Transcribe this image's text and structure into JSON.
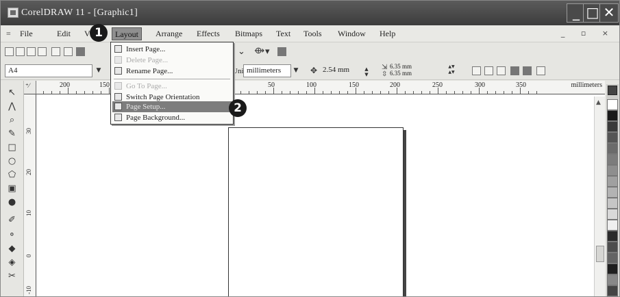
{
  "window": {
    "title": "CorelDRAW 11 - [Graphic1]",
    "controls": {
      "minimize": "_",
      "maximize": "□",
      "close": "✕"
    }
  },
  "menubar": {
    "system_icon": "≡",
    "items": [
      "File",
      "Edit",
      "View",
      "Layout",
      "Arrange",
      "Effects",
      "Bitmaps",
      "Text",
      "Tools",
      "Window",
      "Help"
    ],
    "active": "Layout",
    "mdi_controls": "_ ▫ ×"
  },
  "property_bar": {
    "paper_size": "A4",
    "units_label": "Units:",
    "units_value": "millimeters",
    "nudge_value": "2.54 mm",
    "duplicate_x": "6.35 mm",
    "duplicate_y": "6.35 mm"
  },
  "layout_menu": {
    "items": [
      {
        "label": "Insert Page...",
        "state": "enabled"
      },
      {
        "label": "Delete Page...",
        "state": "disabled"
      },
      {
        "label": "Rename Page...",
        "state": "enabled"
      },
      {
        "label": "Go To Page...",
        "state": "disabled"
      },
      {
        "label": "Switch Page Orientation",
        "state": "enabled"
      },
      {
        "label": "Page Setup...",
        "state": "highlighted"
      },
      {
        "label": "Page Background...",
        "state": "enabled"
      }
    ]
  },
  "ruler": {
    "h_labels": [
      "200",
      "150",
      "50",
      "100",
      "150",
      "200",
      "250",
      "300",
      "350"
    ],
    "units": "millimeters",
    "v_labels": [
      "30",
      "20",
      "10",
      "0",
      "-10"
    ]
  },
  "callouts": [
    "1",
    "2"
  ],
  "icons": {
    "toolbox": [
      "pick-tool",
      "shape-tool",
      "zoom-tool",
      "freehand-tool",
      "rectangle-tool",
      "ellipse-tool",
      "polygon-tool",
      "text-tool",
      "interactive-fill-tool",
      "eyedropper-tool",
      "outline-tool",
      "fill-tool",
      "interactive-tool",
      "eraser-tool"
    ],
    "palette_colors": [
      "#ffffff",
      "#1a1a1a",
      "#3a3a3a",
      "#555555",
      "#6b6b6b",
      "#7c7c7c",
      "#8e8e8e",
      "#a0a0a0",
      "#b3b3b3",
      "#c6c6c6",
      "#d9d9d9",
      "#efefef",
      "#2b2b2b",
      "#4d4d4d",
      "#646464",
      "#1f1f1f",
      "#888888",
      "#444444"
    ]
  }
}
